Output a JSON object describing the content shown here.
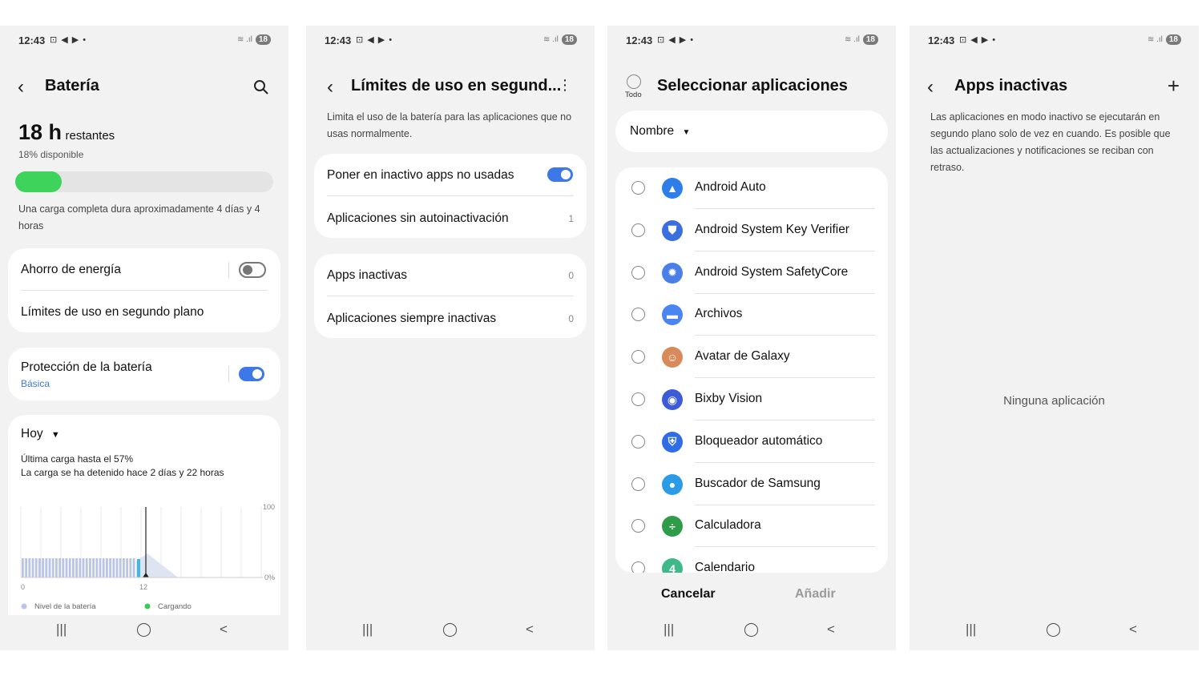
{
  "status": {
    "time": "12:43",
    "icons": "⊡ ◀ ▶ •",
    "signal": "≋ .ıl",
    "battery": "18"
  },
  "nav": {
    "recent": "|||",
    "home": "◯",
    "back": "<"
  },
  "screen1": {
    "title": "Batería",
    "hours_big": "18 h",
    "hours_suffix": "restantes",
    "available": "18% disponible",
    "battery_level": 0.18,
    "full_charge": "Una carga completa dura aproximadamente 4 días y 4 horas",
    "power_saving": "Ahorro de energía",
    "bg_limits": "Límites de uso en segundo plano",
    "protection": "Protección de la batería",
    "protection_sub": "Básica",
    "period": "Hoy",
    "last_charge": "Última carga hasta el 57%",
    "charge_stopped": "La carga se ha detenido hace 2 días y 22 horas",
    "chart": {
      "y_top": "100",
      "y_bottom": "0%",
      "x_start": "0",
      "x_mid": "12",
      "legend_level": "Nivel de la batería",
      "legend_charging": "Cargando",
      "level_color": "#b9c4e6",
      "charging_color": "#3ec95c"
    }
  },
  "screen2": {
    "title": "Límites de uso en segund...",
    "description": "Limita el uso de la batería para las aplicaciones que no usas normalmente.",
    "items": [
      {
        "label": "Poner en inactivo apps no usadas"
      },
      {
        "label": "Aplicaciones sin autoinactivación",
        "count": "1"
      },
      {
        "label": "Apps inactivas",
        "count": "0"
      },
      {
        "label": "Aplicaciones siempre inactivas",
        "count": "0"
      }
    ]
  },
  "screen3": {
    "todo_label": "Todo",
    "title": "Seleccionar aplicaciones",
    "sort": "Nombre",
    "apps": [
      {
        "name": "Android Auto",
        "icon": "android-auto-icon",
        "color": "#2d7ee8"
      },
      {
        "name": "Android System Key Verifier",
        "icon": "key-verifier-icon",
        "color": "#3a6fe0"
      },
      {
        "name": "Android System SafetyCore",
        "icon": "safetycore-icon",
        "color": "#4a7fe8"
      },
      {
        "name": "Archivos",
        "icon": "folder-icon",
        "color": "#4a86ef"
      },
      {
        "name": "Avatar de Galaxy",
        "icon": "avatar-icon",
        "color": "#d98a5a"
      },
      {
        "name": "Bixby Vision",
        "icon": "eye-icon",
        "color": "#3d5bd9"
      },
      {
        "name": "Bloqueador automático",
        "icon": "shield-icon",
        "color": "#2f6de6"
      },
      {
        "name": "Buscador de Samsung",
        "icon": "location-icon",
        "color": "#2b9be8"
      },
      {
        "name": "Calculadora",
        "icon": "calculator-icon",
        "color": "#2f9c4a"
      },
      {
        "name": "Calendario",
        "icon": "calendar-icon",
        "color": "#3fb987"
      }
    ],
    "cancel": "Cancelar",
    "add": "Añadir"
  },
  "screen4": {
    "title": "Apps inactivas",
    "description": "Las aplicaciones en modo inactivo se ejecutarán en segundo plano solo de vez en cuando. Es posible que las actualizaciones y notificaciones se reciban con retraso.",
    "empty": "Ninguna aplicación"
  }
}
